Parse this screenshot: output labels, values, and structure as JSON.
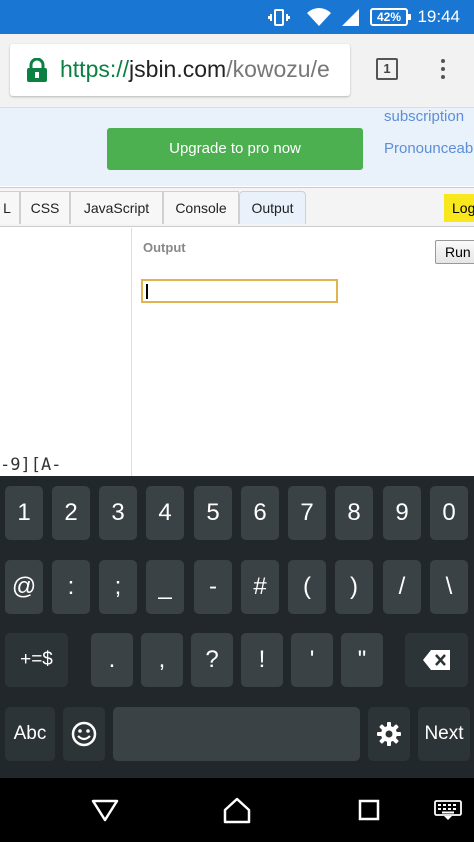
{
  "status_bar": {
    "battery": "42%",
    "time": "19:44",
    "icons": [
      "vibrate-icon",
      "wifi-icon",
      "signal-icon",
      "battery-icon"
    ]
  },
  "browser": {
    "url_scheme": "https://",
    "url_host": "jsbin.com",
    "url_path": "/kowozu/e",
    "tab_count": "1",
    "icons": [
      "lock-icon",
      "overflow-menu-icon"
    ]
  },
  "page": {
    "upgrade_button": "Upgrade to pro now",
    "banner_link_1": "subscription",
    "banner_link_2": "Pronounceab",
    "tabs": [
      "L",
      "CSS",
      "JavaScript",
      "Console",
      "Output"
    ],
    "active_tab": "Output",
    "login_label": "Log",
    "output_label": "Output",
    "run_button": "Run",
    "code_fragment": "-9][A-",
    "input_value": ""
  },
  "keyboard": {
    "row1": [
      "1",
      "2",
      "3",
      "4",
      "5",
      "6",
      "7",
      "8",
      "9",
      "0"
    ],
    "row2": [
      "@",
      ":",
      ";",
      "_",
      "-",
      "#",
      "(",
      ")",
      "/",
      "\\"
    ],
    "row3": [
      "+=$",
      ".",
      ",",
      "?",
      "!",
      "'",
      "\""
    ],
    "row4": [
      "Abc",
      "Next"
    ],
    "icons": [
      "backspace-icon",
      "emoji-icon",
      "gear-icon"
    ]
  },
  "nav": {
    "icons": [
      "back-icon",
      "home-icon",
      "recents-icon",
      "keyboard-switch-icon"
    ]
  },
  "colors": {
    "status_bar": "#1976d2",
    "upgrade_green": "#4caf50",
    "keyboard_bg": "#21272b",
    "key_bg": "#3b4246",
    "input_focus": "#e0b34f"
  }
}
